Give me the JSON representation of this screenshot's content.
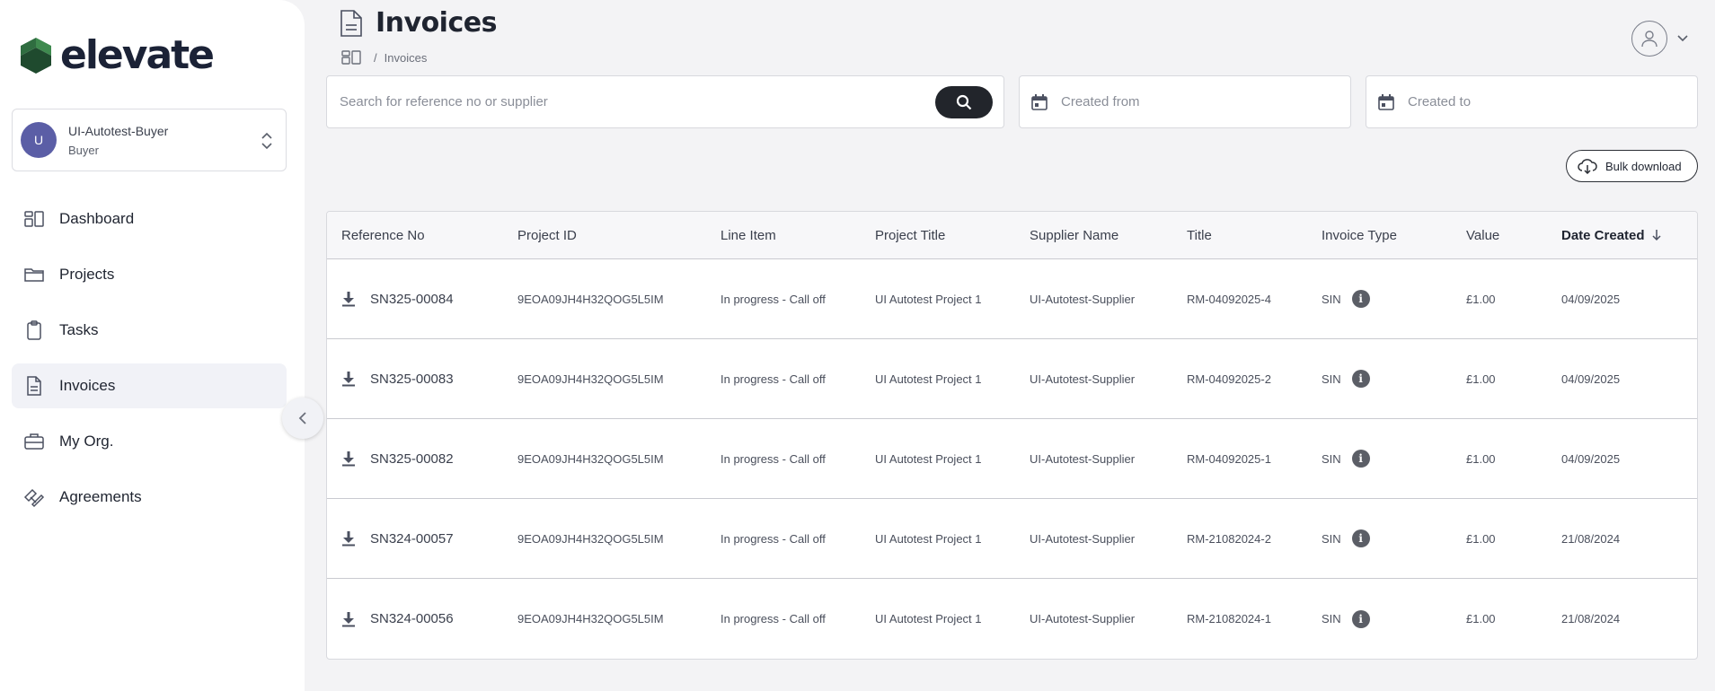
{
  "brand": {
    "name": "elevate",
    "mark_color": "#2b6a3f"
  },
  "account": {
    "initial": "U",
    "name": "UI-Autotest-Buyer",
    "role": "Buyer",
    "avatar_color": "#5b5ea6"
  },
  "nav": [
    {
      "label": "Dashboard",
      "icon": "dashboard-icon"
    },
    {
      "label": "Projects",
      "icon": "folder-icon"
    },
    {
      "label": "Tasks",
      "icon": "clipboard-icon"
    },
    {
      "label": "Invoices",
      "icon": "document-icon",
      "active": true
    },
    {
      "label": "My Org.",
      "icon": "briefcase-icon"
    },
    {
      "label": "Agreements",
      "icon": "handshake-icon"
    }
  ],
  "page": {
    "title": "Invoices",
    "breadcrumb": "Invoices",
    "breadcrumb_sep": "/"
  },
  "search": {
    "placeholder": "Search for reference no or supplier",
    "value": ""
  },
  "filters": {
    "created_from_placeholder": "Created from",
    "created_to_placeholder": "Created to"
  },
  "bulk_download_label": "Bulk download",
  "table": {
    "columns": [
      "Reference No",
      "Project ID",
      "Line Item",
      "Project Title",
      "Supplier Name",
      "Title",
      "Invoice Type",
      "Value",
      "Date Created"
    ],
    "sorted_column": "Date Created",
    "rows": [
      {
        "ref": "SN325-00084",
        "project_id": "9EOA09JH4H32QOG5L5IM",
        "line_item": "In progress - Call off",
        "project_title": "UI Autotest Project 1",
        "supplier": "UI-Autotest-Supplier",
        "title": "RM-04092025-4",
        "type": "SIN",
        "value": "£1.00",
        "date": "04/09/2025"
      },
      {
        "ref": "SN325-00083",
        "project_id": "9EOA09JH4H32QOG5L5IM",
        "line_item": "In progress - Call off",
        "project_title": "UI Autotest Project 1",
        "supplier": "UI-Autotest-Supplier",
        "title": "RM-04092025-2",
        "type": "SIN",
        "value": "£1.00",
        "date": "04/09/2025"
      },
      {
        "ref": "SN325-00082",
        "project_id": "9EOA09JH4H32QOG5L5IM",
        "line_item": "In progress - Call off",
        "project_title": "UI Autotest Project 1",
        "supplier": "UI-Autotest-Supplier",
        "title": "RM-04092025-1",
        "type": "SIN",
        "value": "£1.00",
        "date": "04/09/2025"
      },
      {
        "ref": "SN324-00057",
        "project_id": "9EOA09JH4H32QOG5L5IM",
        "line_item": "In progress - Call off",
        "project_title": "UI Autotest Project 1",
        "supplier": "UI-Autotest-Supplier",
        "title": "RM-21082024-2",
        "type": "SIN",
        "value": "£1.00",
        "date": "21/08/2024"
      },
      {
        "ref": "SN324-00056",
        "project_id": "9EOA09JH4H32QOG5L5IM",
        "line_item": "In progress - Call off",
        "project_title": "UI Autotest Project 1",
        "supplier": "UI-Autotest-Supplier",
        "title": "RM-21082024-1",
        "type": "SIN",
        "value": "£1.00",
        "date": "21/08/2024"
      }
    ]
  }
}
